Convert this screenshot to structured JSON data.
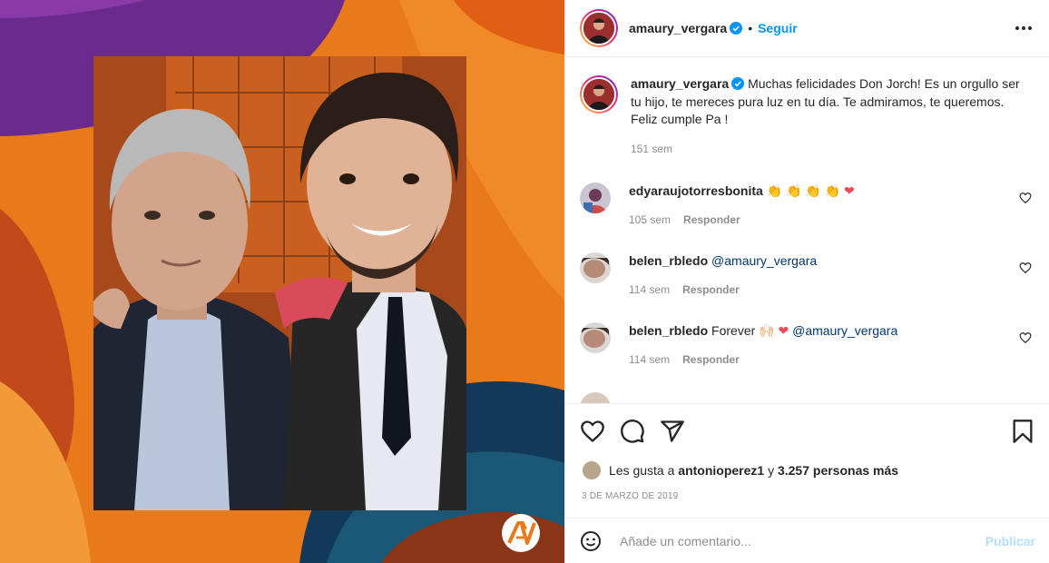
{
  "post": {
    "author": "amaury_vergara",
    "follow_label": "Seguir",
    "separator": "•",
    "caption": "Muchas felicidades Don Jorch! Es un orgullo ser tu hijo, te mereces pura luz en tu día. Te admiramos, te queremos. Feliz cumple Pa !",
    "caption_age": "151 sem",
    "brand_logo_text": "AV"
  },
  "comments": [
    {
      "user": "edyaraujotorresbonita",
      "text": "👏 👏 👏 👏",
      "heart": "❤",
      "age": "105 sem",
      "reply": "Responder"
    },
    {
      "user": "belen_rbledo",
      "text": "",
      "mention": "@amaury_vergara",
      "age": "114 sem",
      "reply": "Responder"
    },
    {
      "user": "belen_rbledo",
      "text": "Forever 🙌🏻",
      "heart": "❤",
      "mention": "@amaury_vergara",
      "age": "114 sem",
      "reply": "Responder"
    }
  ],
  "likes": {
    "prefix": "Les gusta a",
    "user": "antonioperez1",
    "conj": "y",
    "others": "3.257 personas más"
  },
  "date": "3 DE MARZO DE 2019",
  "add_comment": {
    "placeholder": "Añade un comentario...",
    "publish_label": "Publicar"
  },
  "colors": {
    "accent": "#0095f6",
    "mention": "#00376b",
    "muted": "#8e8e8e",
    "publish_disabled": "#b2dffc",
    "heart": "#ed4956"
  }
}
